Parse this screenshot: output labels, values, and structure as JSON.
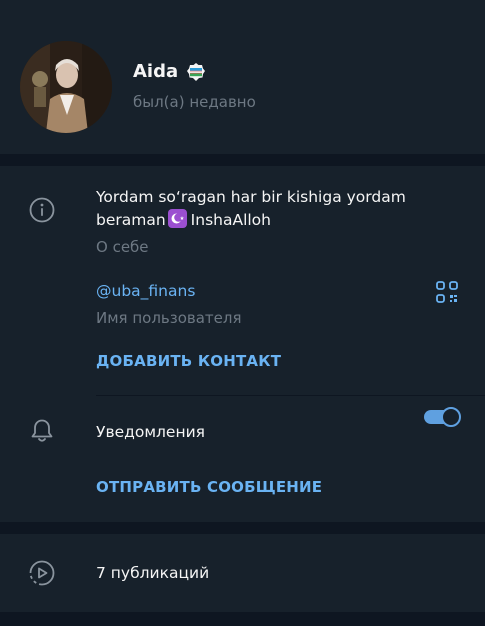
{
  "profile": {
    "name": "Aida",
    "status": "был(а) недавно"
  },
  "info": {
    "bio": "Yordam so‘ragan har bir kishiga yordam",
    "bio_line2_start": "beraman",
    "bio_line2_end": "InshaAlloh",
    "bio_caption": "О себе",
    "username": "@uba_finans",
    "username_caption": "Имя пользователя",
    "add_contact": "ДОБАВИТЬ КОНТАКТ"
  },
  "notifications": {
    "label": "Уведомления",
    "enabled": true,
    "send_message": "ОТПРАВИТЬ СООБЩЕНИЕ"
  },
  "posts": {
    "label": "7 публикаций"
  },
  "colors": {
    "background": "#17212b",
    "separator": "#0e1621",
    "accent": "#6ab3f3",
    "muted": "#6d7883"
  }
}
